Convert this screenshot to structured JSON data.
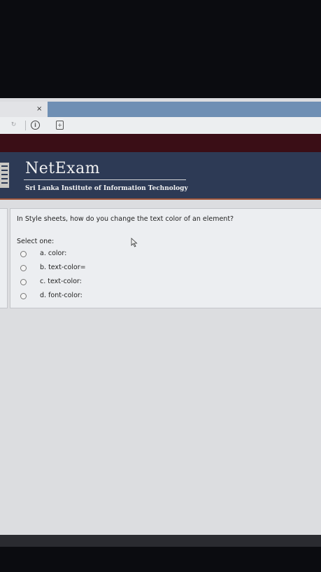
{
  "browser": {
    "tab_close": "×",
    "info_icon": "i",
    "page_icon": "+"
  },
  "header": {
    "title": "NetExam",
    "subtitle": "Sri Lanka Institute of Information Technology"
  },
  "quiz": {
    "question": "In Style sheets, how do you change the text color of an element?",
    "select_prompt": "Select one:",
    "options": [
      {
        "label": "a. color:",
        "selected": false
      },
      {
        "label": "b. text-color=",
        "selected": false
      },
      {
        "label": "c. text-color:",
        "selected": false
      },
      {
        "label": "d. font-color:",
        "selected": false
      }
    ]
  },
  "colors": {
    "header_bg": "#2d3a55",
    "accent_line": "#a0553a",
    "tab_active": "#6f8fb4"
  },
  "icons": [
    "close-icon",
    "reload-icon",
    "info-icon",
    "page-icon",
    "logo-icon",
    "mouse-cursor-icon",
    "radio-icon"
  ]
}
